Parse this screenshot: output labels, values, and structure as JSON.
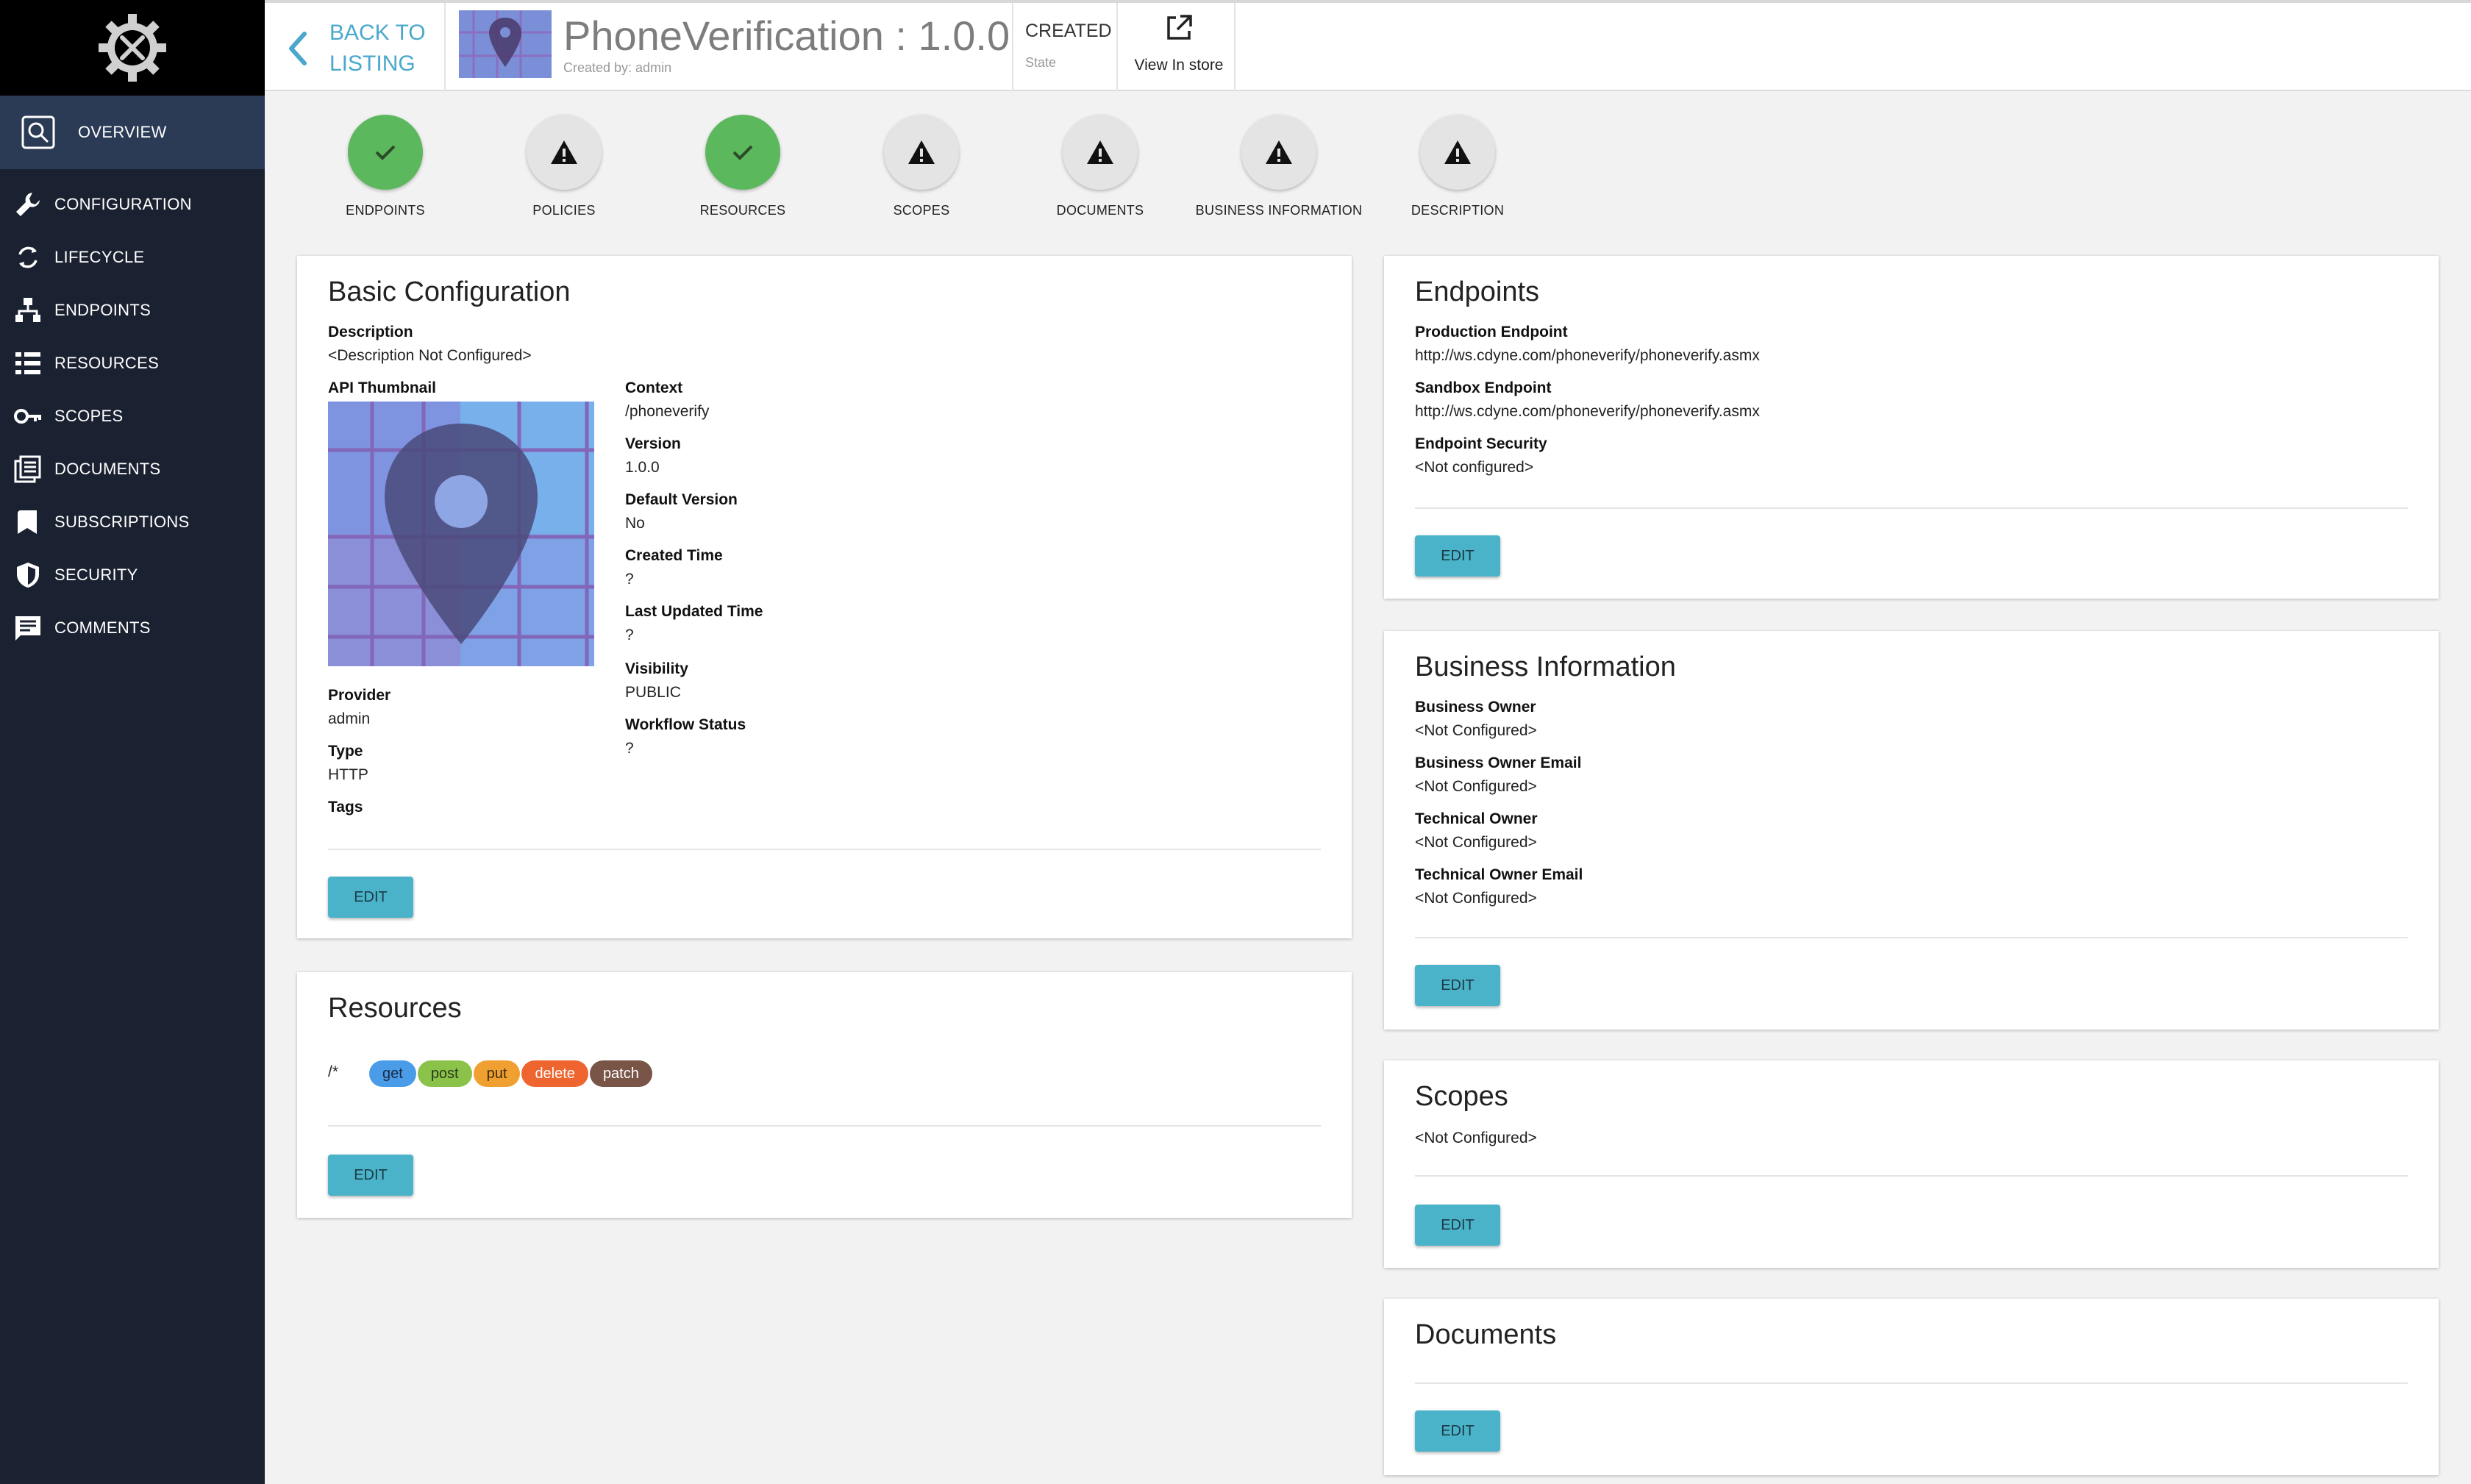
{
  "sidebar": {
    "items": [
      {
        "label": "OVERVIEW",
        "icon": "overview-icon"
      },
      {
        "label": "CONFIGURATION",
        "icon": "wrench-icon"
      },
      {
        "label": "LIFECYCLE",
        "icon": "lifecycle-icon"
      },
      {
        "label": "ENDPOINTS",
        "icon": "endpoints-icon"
      },
      {
        "label": "RESOURCES",
        "icon": "resources-icon"
      },
      {
        "label": "SCOPES",
        "icon": "key-icon"
      },
      {
        "label": "DOCUMENTS",
        "icon": "documents-icon"
      },
      {
        "label": "SUBSCRIPTIONS",
        "icon": "bookmark-icon"
      },
      {
        "label": "SECURITY",
        "icon": "shield-icon"
      },
      {
        "label": "COMMENTS",
        "icon": "comment-icon"
      }
    ]
  },
  "header": {
    "back_line1": "BACK TO",
    "back_line2": "LISTING",
    "title": "PhoneVerification : 1.0.0",
    "created_by": "Created by: admin",
    "state_value": "CREATED",
    "state_label": "State",
    "store_label": "View In store"
  },
  "progress": {
    "steps": [
      {
        "label": "ENDPOINTS",
        "status": "done"
      },
      {
        "label": "POLICIES",
        "status": "warning"
      },
      {
        "label": "RESOURCES",
        "status": "done"
      },
      {
        "label": "SCOPES",
        "status": "warning"
      },
      {
        "label": "DOCUMENTS",
        "status": "warning"
      },
      {
        "label": "BUSINESS INFORMATION",
        "status": "warning"
      },
      {
        "label": "DESCRIPTION",
        "status": "warning"
      }
    ]
  },
  "basic": {
    "title": "Basic Configuration",
    "description_label": "Description",
    "description_value": "<Description Not Configured>",
    "thumbnail_label": "API Thumbnail",
    "provider_label": "Provider",
    "provider_value": "admin",
    "type_label": "Type",
    "type_value": "HTTP",
    "tags_label": "Tags",
    "context_label": "Context",
    "context_value": "/phoneverify",
    "version_label": "Version",
    "version_value": "1.0.0",
    "default_version_label": "Default Version",
    "default_version_value": "No",
    "created_time_label": "Created Time",
    "created_time_value": "?",
    "updated_time_label": "Last Updated Time",
    "updated_time_value": "?",
    "visibility_label": "Visibility",
    "visibility_value": "PUBLIC",
    "workflow_label": "Workflow Status",
    "workflow_value": "?",
    "edit": "EDIT"
  },
  "resources": {
    "title": "Resources",
    "path": "/*",
    "methods": [
      {
        "label": "get",
        "color": "#4a9be8"
      },
      {
        "label": "post",
        "color": "#8bc34a"
      },
      {
        "label": "put",
        "color": "#f0a030"
      },
      {
        "label": "delete",
        "color": "#ef6530"
      },
      {
        "label": "patch",
        "color": "#795548"
      }
    ],
    "edit": "EDIT"
  },
  "endpoints": {
    "title": "Endpoints",
    "production_label": "Production Endpoint",
    "production_value": "http://ws.cdyne.com/phoneverify/phoneverify.asmx",
    "sandbox_label": "Sandbox Endpoint",
    "sandbox_value": "http://ws.cdyne.com/phoneverify/phoneverify.asmx",
    "security_label": "Endpoint Security",
    "security_value": "<Not configured>",
    "edit": "EDIT"
  },
  "business": {
    "title": "Business Information",
    "owner_label": "Business Owner",
    "owner_value": "<Not Configured>",
    "owner_email_label": "Business Owner Email",
    "owner_email_value": "<Not Configured>",
    "tech_owner_label": "Technical Owner",
    "tech_owner_value": "<Not Configured>",
    "tech_email_label": "Technical Owner Email",
    "tech_email_value": "<Not Configured>",
    "edit": "EDIT"
  },
  "scopes": {
    "title": "Scopes",
    "value": "<Not Configured>",
    "edit": "EDIT"
  },
  "documents": {
    "title": "Documents",
    "edit": "EDIT"
  },
  "colors": {
    "sidebar_bg": "#1a2130",
    "accent": "#4bb3c9",
    "success": "#5cb85c",
    "link": "#4aa8cc"
  }
}
